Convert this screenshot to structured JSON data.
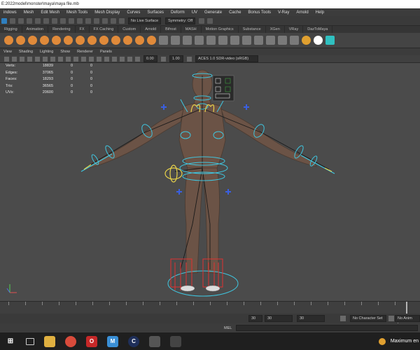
{
  "window": {
    "title": "E:2022model\\monster\\maya\\maya file.mb"
  },
  "menu": [
    "indows",
    "Mesh",
    "Edit Mesh",
    "Mesh Tools",
    "Mesh Display",
    "Curves",
    "Surfaces",
    "Deform",
    "UV",
    "Generate",
    "Cache",
    "Bonus Tools",
    "V-Ray",
    "Arnold",
    "Help"
  ],
  "status_line": {
    "live_surface": "No Live Surface",
    "symmetry": "Symmetry: Off"
  },
  "shelf_tabs": [
    "Rigging",
    "Animation",
    "Rendering",
    "FX",
    "FX Caching",
    "Custom",
    "Arnold",
    "Bifrost",
    "MASH",
    "Motion Graphics",
    "Substance",
    "XGen",
    "VRay",
    "DazToMaya"
  ],
  "panel_menu": [
    "View",
    "Shading",
    "Lighting",
    "Show",
    "Renderer",
    "Panels"
  ],
  "panel_tools": {
    "exposure": "0.00",
    "gamma": "1.00",
    "colorspace": "ACES 1.0 SDR-video (sRGB)"
  },
  "hud": {
    "rows": [
      {
        "label": "Verts:",
        "v1": "18839",
        "v2": "0",
        "v3": "0"
      },
      {
        "label": "Edges:",
        "v1": "37065",
        "v2": "0",
        "v3": "0"
      },
      {
        "label": "Faces:",
        "v1": "18293",
        "v2": "0",
        "v3": "0"
      },
      {
        "label": "Tris:",
        "v1": "36565",
        "v2": "0",
        "v3": "0"
      },
      {
        "label": "UVs:",
        "v1": "20600",
        "v2": "0",
        "v3": "0"
      }
    ]
  },
  "range": {
    "start": "30",
    "current": "30",
    "end": "30",
    "character_set": "No Character Set",
    "anim_layer": "No Anim Layer"
  },
  "command_line": {
    "label": "MEL"
  },
  "taskbar": {
    "notification": "Maximum en"
  },
  "colors": {
    "rig_cyan": "#3fc6e0",
    "rig_yellow": "#e8d24a",
    "rig_red": "#e03030",
    "viewport_bg": "#4b4b4b"
  }
}
